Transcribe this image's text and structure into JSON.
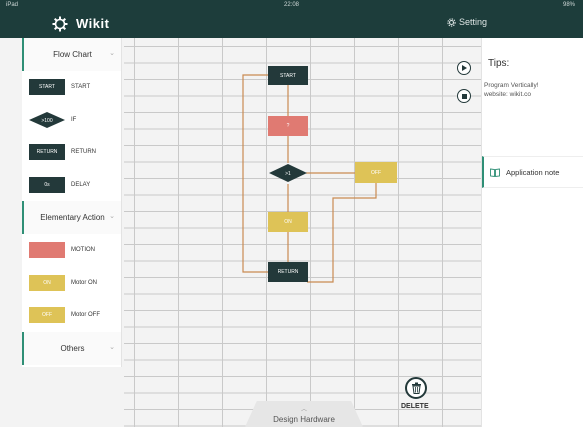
{
  "status": {
    "device": "iPad",
    "time": "22:08",
    "battery": "98%"
  },
  "app": {
    "title": "Wikit",
    "setting_label": "Setting"
  },
  "palette": {
    "flow_chart": {
      "title": "Flow Chart",
      "items": [
        {
          "shape_text": "START",
          "label": "START"
        },
        {
          "shape_text": ">100",
          "label": "IF"
        },
        {
          "shape_text": "RETURN",
          "label": "RETURN"
        },
        {
          "shape_text": "0s",
          "label": "DELAY"
        }
      ]
    },
    "elementary_action": {
      "title": "Elementary Action",
      "items": [
        {
          "shape_text": "",
          "label": "MOTION"
        },
        {
          "shape_text": "ON",
          "label": "Motor ON"
        },
        {
          "shape_text": "OFF",
          "label": "Motor OFF"
        }
      ]
    },
    "others": {
      "title": "Others"
    }
  },
  "flow": {
    "start": "START",
    "motion": "?",
    "if": ">1",
    "off": "OFF",
    "on": "ON",
    "return": "RETURN"
  },
  "canvas": {
    "delete_label": "DELETE",
    "design_hardware_label": "Design Hardware"
  },
  "tips": {
    "title": "Tips:",
    "line1": "Program Vertically!",
    "line2": "website: wikit.co",
    "app_note": "Application note"
  },
  "colors": {
    "dark": "#23393a",
    "motion": "#e07a72",
    "motor": "#dec357",
    "accent": "#2f8f76",
    "header": "#1d3d3b"
  }
}
